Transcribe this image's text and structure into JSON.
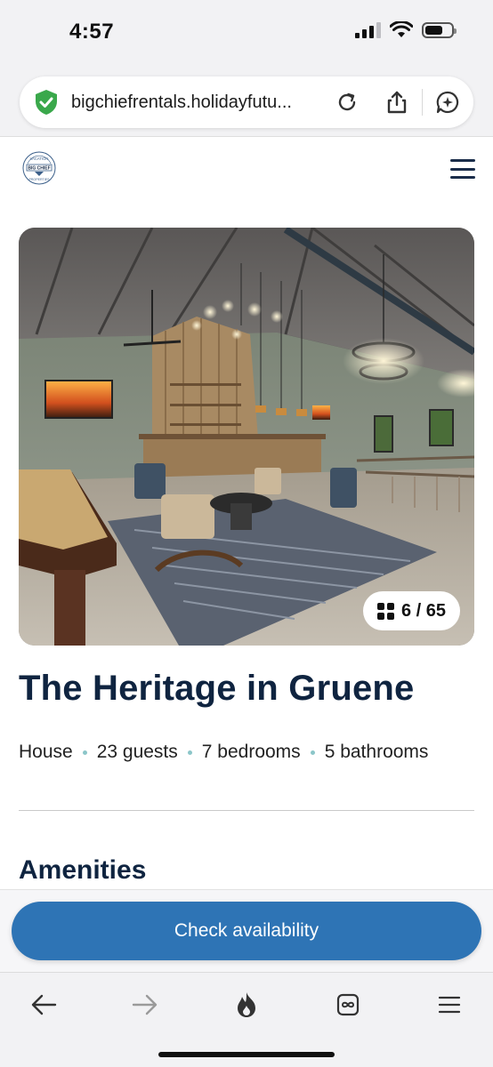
{
  "status_bar": {
    "time": "4:57",
    "signal_bars": 3,
    "battery_level": 0.68
  },
  "browser": {
    "url": "bigchiefrentals.holidayfutu...",
    "security_icon": "shield-check-icon",
    "buttons": [
      "reload-icon",
      "share-icon",
      "ai-assistant-icon"
    ]
  },
  "site": {
    "logo_text_top": "VACATION",
    "logo_text_middle": "BIG CHIEF",
    "logo_text_bottom": "PROPERTIES",
    "menu_icon": "hamburger-menu-icon"
  },
  "gallery": {
    "counter": "6 / 65",
    "counter_icon": "grid-icon"
  },
  "listing": {
    "title": "The Heritage in Gruene",
    "meta": [
      "House",
      "23 guests",
      "7 bedrooms",
      "5 bathrooms"
    ],
    "section_heading": "Amenities"
  },
  "cta": {
    "label": "Check availability"
  },
  "toolbar": {
    "items": [
      "back-arrow-icon",
      "forward-arrow-icon",
      "flame-icon",
      "tabs-infinity-icon",
      "menu-icon"
    ]
  },
  "colors": {
    "brand_navy": "#0f2440",
    "cta_blue": "#2e74b5",
    "dot_teal": "#8cc6c9",
    "shield_green": "#3aa84b"
  }
}
